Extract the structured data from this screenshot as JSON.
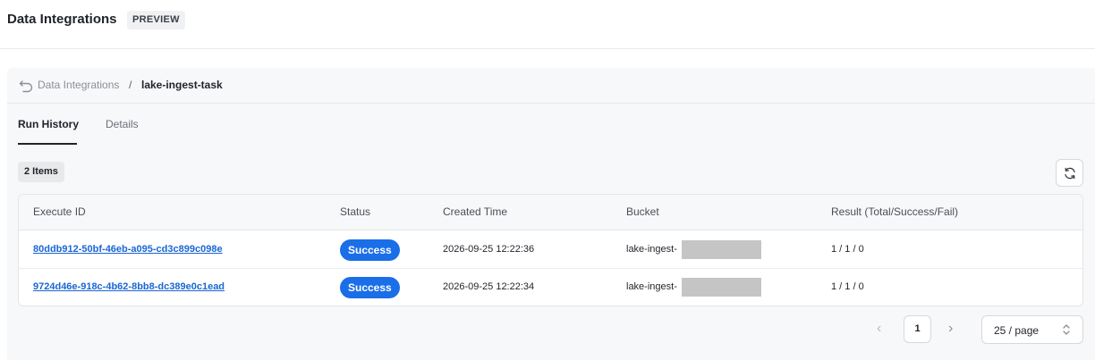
{
  "header": {
    "title": "Data Integrations",
    "badge": "PREVIEW"
  },
  "breadcrumb": {
    "parent": "Data Integrations",
    "separator": "/",
    "current": "lake-ingest-task"
  },
  "tabs": [
    {
      "label": "Run History",
      "active": true
    },
    {
      "label": "Details",
      "active": false
    }
  ],
  "toolbar": {
    "items_count": "2 Items",
    "refresh_icon": "refresh-icon"
  },
  "table": {
    "columns": [
      "Execute ID",
      "Status",
      "Created Time",
      "Bucket",
      "Result (Total/Success/Fail)"
    ],
    "rows": [
      {
        "execute_id": "80ddb912-50bf-46eb-a095-cd3c899c098e",
        "status": "Success",
        "created_time": "2026-09-25 12:22:36",
        "bucket": "lake-ingest-",
        "result": "1 / 1 / 0"
      },
      {
        "execute_id": "9724d46e-918c-4b62-8bb8-dc389e0c1ead",
        "status": "Success",
        "created_time": "2026-09-25 12:22:34",
        "bucket": "lake-ingest-",
        "result": "1 / 1 / 0"
      }
    ]
  },
  "pagination": {
    "current_page": "1",
    "page_size": "25 / page"
  },
  "colors": {
    "accent": "#1a66d4",
    "status_success": "#1a6ee8"
  }
}
